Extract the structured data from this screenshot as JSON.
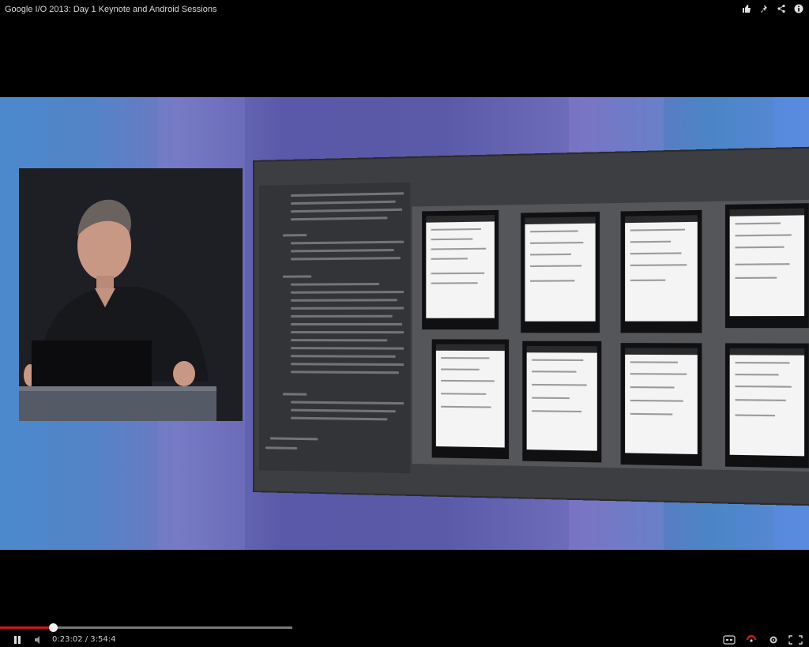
{
  "video": {
    "title": "Google I/O 2013: Day 1 Keynote and Android Sessions"
  },
  "top_icons": [
    "thumbs-up-icon",
    "pin-icon",
    "share-icon",
    "info-icon"
  ],
  "playback": {
    "current_time": "0:23:02",
    "duration": "3:54:4",
    "time_separator": " / ",
    "played_fraction": 0.18
  },
  "right_controls": [
    "captions-icon",
    "hd-icon",
    "settings-icon",
    "fullscreen-icon"
  ],
  "colors": {
    "progress_played": "#cc181e",
    "background": "#000000"
  }
}
